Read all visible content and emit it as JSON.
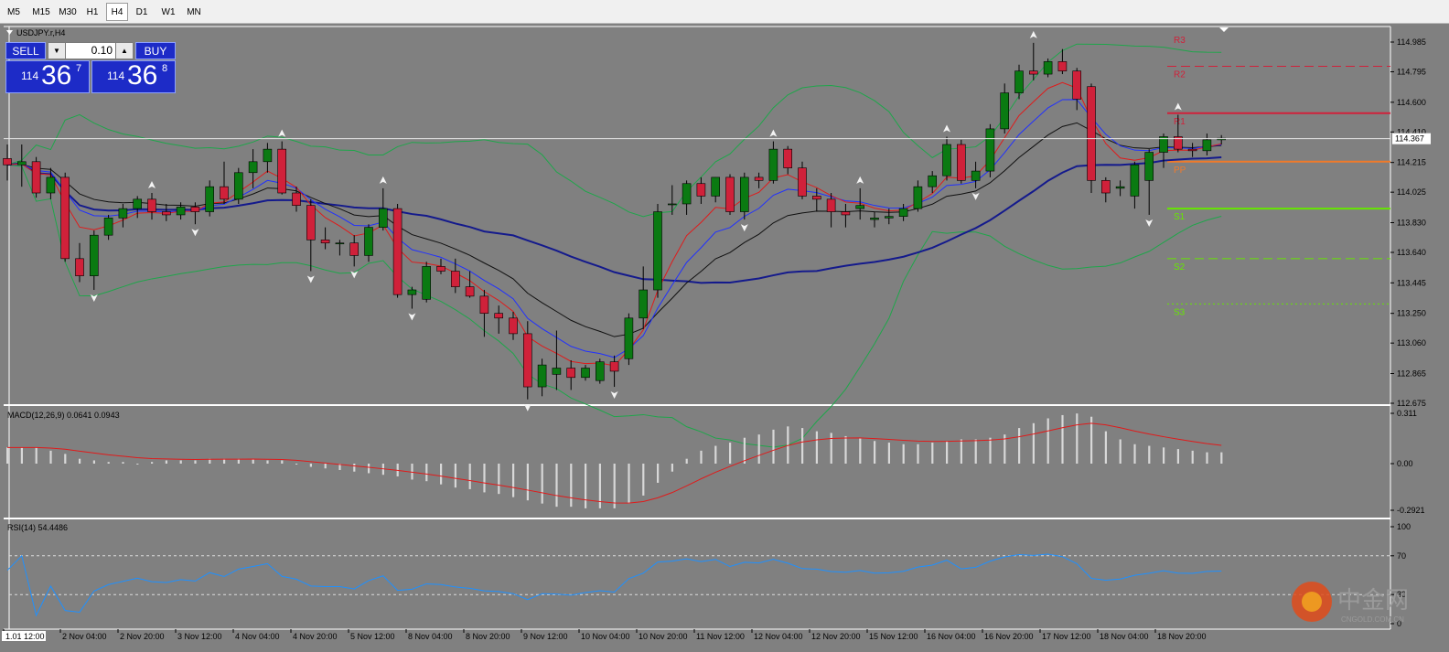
{
  "timeframes": [
    "M5",
    "M15",
    "M30",
    "H1",
    "H4",
    "D1",
    "W1",
    "MN"
  ],
  "active_timeframe": "H4",
  "chart": {
    "symbol_title": "USDJPY.r,H4",
    "current_price_label": "114.367"
  },
  "trade_panel": {
    "sell_label": "SELL",
    "buy_label": "BUY",
    "lot_value": "0.10",
    "sell_price": {
      "major": "114",
      "big": "36",
      "sup": "7"
    },
    "buy_price": {
      "major": "114",
      "big": "36",
      "sup": "8"
    }
  },
  "price_axis": [
    "114.985",
    "114.795",
    "114.600",
    "114.410",
    "114.215",
    "114.025",
    "113.830",
    "113.640",
    "113.445",
    "113.250",
    "113.060",
    "112.865",
    "112.675"
  ],
  "pivots": [
    {
      "label": "R3",
      "color": "#d0213a",
      "style": "none"
    },
    {
      "label": "R2",
      "color": "#d0213a",
      "style": "dash"
    },
    {
      "label": "R1",
      "color": "#d0213a",
      "style": "solid"
    },
    {
      "label": "PP",
      "color": "#f07a2a",
      "style": "solid"
    },
    {
      "label": "S1",
      "color": "#66e600",
      "style": "solid"
    },
    {
      "label": "S2",
      "color": "#66e600",
      "style": "dash"
    },
    {
      "label": "S3",
      "color": "#66e600",
      "style": "dot"
    }
  ],
  "macd": {
    "label": "MACD(12,26,9) 0.0641 0.0943",
    "axis": [
      "0.311",
      "0.00",
      "-0.2921"
    ]
  },
  "rsi": {
    "label": "RSI(14) 54.4486",
    "axis": [
      "100",
      "70",
      "30",
      "0"
    ]
  },
  "time_axis": [
    "1.01 12:00",
    "2 Nov 04:00",
    "2 Nov 20:00",
    "3 Nov 12:00",
    "4 Nov 04:00",
    "4 Nov 20:00",
    "5 Nov 12:00",
    "8 Nov 04:00",
    "8 Nov 20:00",
    "9 Nov 12:00",
    "10 Nov 04:00",
    "10 Nov 20:00",
    "11 Nov 12:00",
    "12 Nov 04:00",
    "12 Nov 20:00",
    "15 Nov 12:00",
    "16 Nov 04:00",
    "16 Nov 20:00",
    "17 Nov 12:00",
    "18 Nov 04:00",
    "18 Nov 20:00"
  ],
  "watermark": {
    "text": "中金网",
    "sub": "CNGOLD.COM.CN"
  },
  "colors": {
    "background": "#808080",
    "bull": "#0a7a12",
    "bear": "#d0213a",
    "ema_red": "#e01a1a",
    "ema_blue": "#2030ff",
    "sma_black": "#101010",
    "sma_navy": "#141a8c",
    "bollinger": "#1ea64a",
    "macd_signal": "#e01a1a",
    "rsi_line": "#1e90ff"
  },
  "chart_data": {
    "type": "candlestick",
    "series": [
      {
        "name": "price",
        "values": [
          {
            "o": 114.24,
            "h": 114.33,
            "l": 114.1,
            "c": 114.2
          },
          {
            "o": 114.2,
            "h": 114.33,
            "l": 114.06,
            "c": 114.22
          },
          {
            "o": 114.22,
            "h": 114.25,
            "l": 113.99,
            "c": 114.02
          },
          {
            "o": 114.02,
            "h": 114.18,
            "l": 113.98,
            "c": 114.12
          },
          {
            "o": 114.12,
            "h": 114.15,
            "l": 113.58,
            "c": 113.6
          },
          {
            "o": 113.6,
            "h": 113.7,
            "l": 113.45,
            "c": 113.49
          },
          {
            "o": 113.49,
            "h": 113.78,
            "l": 113.4,
            "c": 113.75
          },
          {
            "o": 113.75,
            "h": 113.88,
            "l": 113.72,
            "c": 113.86
          },
          {
            "o": 113.86,
            "h": 113.95,
            "l": 113.8,
            "c": 113.92
          },
          {
            "o": 113.92,
            "h": 114.0,
            "l": 113.86,
            "c": 113.98
          },
          {
            "o": 113.98,
            "h": 114.02,
            "l": 113.85,
            "c": 113.9
          },
          {
            "o": 113.9,
            "h": 113.95,
            "l": 113.84,
            "c": 113.88
          },
          {
            "o": 113.88,
            "h": 113.96,
            "l": 113.85,
            "c": 113.93
          },
          {
            "o": 113.93,
            "h": 113.96,
            "l": 113.82,
            "c": 113.9
          },
          {
            "o": 113.9,
            "h": 114.1,
            "l": 113.87,
            "c": 114.06
          },
          {
            "o": 114.06,
            "h": 114.22,
            "l": 113.95,
            "c": 113.98
          },
          {
            "o": 113.98,
            "h": 114.18,
            "l": 113.95,
            "c": 114.15
          },
          {
            "o": 114.15,
            "h": 114.3,
            "l": 114.05,
            "c": 114.22
          },
          {
            "o": 114.22,
            "h": 114.34,
            "l": 114.15,
            "c": 114.3
          },
          {
            "o": 114.3,
            "h": 114.35,
            "l": 114.01,
            "c": 114.02
          },
          {
            "o": 114.02,
            "h": 114.06,
            "l": 113.9,
            "c": 113.94
          },
          {
            "o": 113.94,
            "h": 113.98,
            "l": 113.52,
            "c": 113.72
          },
          {
            "o": 113.72,
            "h": 113.8,
            "l": 113.66,
            "c": 113.7
          },
          {
            "o": 113.7,
            "h": 113.72,
            "l": 113.62,
            "c": 113.7
          },
          {
            "o": 113.7,
            "h": 113.75,
            "l": 113.55,
            "c": 113.62
          },
          {
            "o": 113.62,
            "h": 113.82,
            "l": 113.58,
            "c": 113.8
          },
          {
            "o": 113.8,
            "h": 114.05,
            "l": 113.78,
            "c": 113.92
          },
          {
            "o": 113.92,
            "h": 113.95,
            "l": 113.35,
            "c": 113.37
          },
          {
            "o": 113.37,
            "h": 113.42,
            "l": 113.28,
            "c": 113.4
          },
          {
            "o": 113.34,
            "h": 113.58,
            "l": 113.32,
            "c": 113.55
          },
          {
            "o": 113.55,
            "h": 113.6,
            "l": 113.5,
            "c": 113.52
          },
          {
            "o": 113.52,
            "h": 113.6,
            "l": 113.38,
            "c": 113.42
          },
          {
            "o": 113.42,
            "h": 113.52,
            "l": 113.35,
            "c": 113.36
          },
          {
            "o": 113.36,
            "h": 113.4,
            "l": 113.1,
            "c": 113.25
          },
          {
            "o": 113.25,
            "h": 113.3,
            "l": 113.12,
            "c": 113.22
          },
          {
            "o": 113.22,
            "h": 113.26,
            "l": 113.08,
            "c": 113.12
          },
          {
            "o": 113.12,
            "h": 113.2,
            "l": 112.7,
            "c": 112.78
          },
          {
            "o": 112.78,
            "h": 112.96,
            "l": 112.72,
            "c": 112.92
          },
          {
            "o": 112.86,
            "h": 113.14,
            "l": 112.76,
            "c": 112.9
          },
          {
            "o": 112.9,
            "h": 112.95,
            "l": 112.76,
            "c": 112.84
          },
          {
            "o": 112.84,
            "h": 112.92,
            "l": 112.82,
            "c": 112.9
          },
          {
            "o": 112.82,
            "h": 112.96,
            "l": 112.8,
            "c": 112.94
          },
          {
            "o": 112.94,
            "h": 112.98,
            "l": 112.78,
            "c": 112.88
          },
          {
            "o": 112.96,
            "h": 113.25,
            "l": 112.92,
            "c": 113.22
          },
          {
            "o": 113.22,
            "h": 113.55,
            "l": 113.15,
            "c": 113.4
          },
          {
            "o": 113.4,
            "h": 113.95,
            "l": 113.35,
            "c": 113.9
          },
          {
            "o": 113.95,
            "h": 114.07,
            "l": 113.88,
            "c": 113.95
          },
          {
            "o": 113.95,
            "h": 114.1,
            "l": 113.88,
            "c": 114.08
          },
          {
            "o": 114.08,
            "h": 114.12,
            "l": 113.95,
            "c": 114.0
          },
          {
            "o": 114.0,
            "h": 114.12,
            "l": 113.96,
            "c": 114.12
          },
          {
            "o": 114.12,
            "h": 114.14,
            "l": 113.88,
            "c": 113.9
          },
          {
            "o": 113.9,
            "h": 114.15,
            "l": 113.85,
            "c": 114.12
          },
          {
            "o": 114.12,
            "h": 114.15,
            "l": 114.05,
            "c": 114.1
          },
          {
            "o": 114.1,
            "h": 114.35,
            "l": 114.08,
            "c": 114.3
          },
          {
            "o": 114.3,
            "h": 114.32,
            "l": 114.14,
            "c": 114.18
          },
          {
            "o": 114.18,
            "h": 114.22,
            "l": 113.98,
            "c": 114.0
          },
          {
            "o": 114.0,
            "h": 114.05,
            "l": 113.9,
            "c": 113.98
          },
          {
            "o": 113.98,
            "h": 114.02,
            "l": 113.8,
            "c": 113.9
          },
          {
            "o": 113.9,
            "h": 113.95,
            "l": 113.8,
            "c": 113.88
          },
          {
            "o": 113.92,
            "h": 114.05,
            "l": 113.85,
            "c": 113.94
          },
          {
            "o": 113.85,
            "h": 113.9,
            "l": 113.8,
            "c": 113.86
          },
          {
            "o": 113.86,
            "h": 113.92,
            "l": 113.82,
            "c": 113.87
          },
          {
            "o": 113.87,
            "h": 113.95,
            "l": 113.84,
            "c": 113.92
          },
          {
            "o": 113.92,
            "h": 114.1,
            "l": 113.9,
            "c": 114.06
          },
          {
            "o": 114.06,
            "h": 114.16,
            "l": 114.02,
            "c": 114.13
          },
          {
            "o": 114.13,
            "h": 114.38,
            "l": 114.1,
            "c": 114.33
          },
          {
            "o": 114.33,
            "h": 114.36,
            "l": 114.08,
            "c": 114.1
          },
          {
            "o": 114.1,
            "h": 114.22,
            "l": 114.05,
            "c": 114.16
          },
          {
            "o": 114.16,
            "h": 114.46,
            "l": 114.12,
            "c": 114.43
          },
          {
            "o": 114.43,
            "h": 114.72,
            "l": 114.4,
            "c": 114.66
          },
          {
            "o": 114.66,
            "h": 114.84,
            "l": 114.62,
            "c": 114.8
          },
          {
            "o": 114.8,
            "h": 114.98,
            "l": 114.74,
            "c": 114.78
          },
          {
            "o": 114.78,
            "h": 114.88,
            "l": 114.76,
            "c": 114.86
          },
          {
            "o": 114.86,
            "h": 114.94,
            "l": 114.78,
            "c": 114.8
          },
          {
            "o": 114.8,
            "h": 114.82,
            "l": 114.55,
            "c": 114.62
          },
          {
            "o": 114.7,
            "h": 114.72,
            "l": 114.02,
            "c": 114.1
          },
          {
            "o": 114.1,
            "h": 114.12,
            "l": 113.96,
            "c": 114.02
          },
          {
            "o": 114.05,
            "h": 114.1,
            "l": 114.0,
            "c": 114.06
          },
          {
            "o": 114.0,
            "h": 114.22,
            "l": 113.92,
            "c": 114.2
          },
          {
            "o": 114.1,
            "h": 114.3,
            "l": 113.88,
            "c": 114.28
          },
          {
            "o": 114.28,
            "h": 114.4,
            "l": 114.18,
            "c": 114.38
          },
          {
            "o": 114.38,
            "h": 114.52,
            "l": 114.28,
            "c": 114.3
          },
          {
            "o": 114.3,
            "h": 114.34,
            "l": 114.25,
            "c": 114.29
          },
          {
            "o": 114.29,
            "h": 114.4,
            "l": 114.26,
            "c": 114.36
          },
          {
            "o": 114.36,
            "h": 114.39,
            "l": 114.33,
            "c": 114.37
          }
        ]
      }
    ],
    "ylim": [
      112.675,
      115.05
    ],
    "pivot_levels": {
      "R3": 115.05,
      "R2": 114.83,
      "R1": 114.53,
      "PP": 114.22,
      "S1": 113.92,
      "S2": 113.6,
      "S3": 113.31
    },
    "macd": {
      "histogram": [
        0.1,
        0.1,
        0.1,
        0.08,
        0.06,
        0.03,
        0.02,
        0.01,
        0.01,
        0.0,
        0.01,
        0.02,
        0.02,
        0.02,
        0.03,
        0.03,
        0.03,
        0.03,
        0.02,
        0.02,
        0.0,
        -0.02,
        -0.03,
        -0.04,
        -0.05,
        -0.06,
        -0.07,
        -0.08,
        -0.1,
        -0.11,
        -0.13,
        -0.15,
        -0.16,
        -0.18,
        -0.19,
        -0.21,
        -0.23,
        -0.25,
        -0.27,
        -0.27,
        -0.28,
        -0.28,
        -0.28,
        -0.25,
        -0.2,
        -0.12,
        -0.05,
        0.03,
        0.08,
        0.11,
        0.13,
        0.16,
        0.18,
        0.21,
        0.23,
        0.22,
        0.2,
        0.19,
        0.17,
        0.16,
        0.14,
        0.13,
        0.12,
        0.12,
        0.13,
        0.14,
        0.15,
        0.15,
        0.16,
        0.18,
        0.22,
        0.25,
        0.28,
        0.3,
        0.31,
        0.29,
        0.2,
        0.15,
        0.12,
        0.11,
        0.1,
        0.09,
        0.08,
        0.07,
        0.07
      ],
      "ylim": [
        -0.2921,
        0.311
      ]
    }
  }
}
